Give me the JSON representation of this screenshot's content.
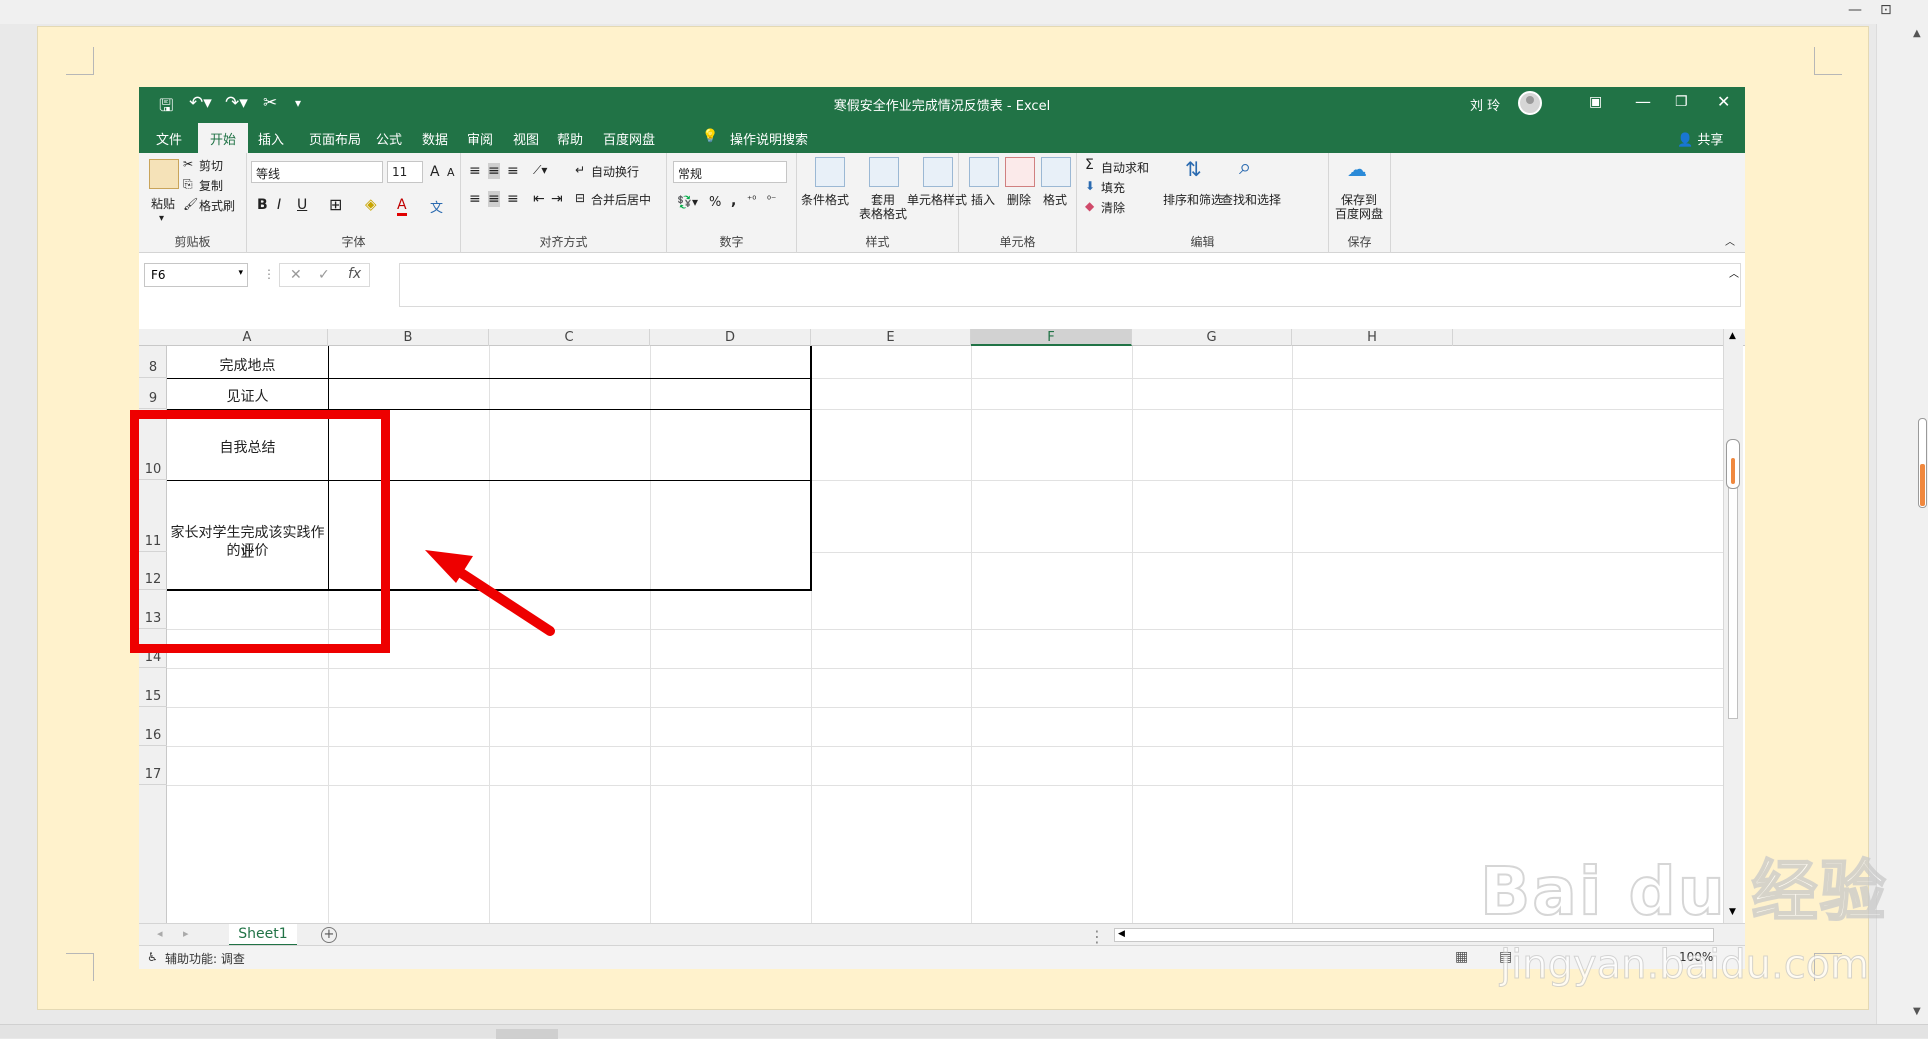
{
  "excel": {
    "title": "寒假安全作业完成情况反馈表 - Excel",
    "user": "刘 玲",
    "share": "共享",
    "tabs": [
      "文件",
      "开始",
      "插入",
      "页面布局",
      "公式",
      "数据",
      "审阅",
      "视图",
      "帮助",
      "百度网盘"
    ],
    "active_tab": "开始",
    "tell_me": "操作说明搜索",
    "ribbon": {
      "clipboard": {
        "paste": "粘贴",
        "cut": "剪切",
        "copy": "复制",
        "format_painter": "格式刷",
        "label": "剪贴板"
      },
      "font": {
        "font_name": "等线",
        "font_size": "11",
        "bold": "B",
        "italic": "I",
        "underline": "U",
        "label": "字体",
        "grow": "A",
        "shrink": "A",
        "color_a": "A",
        "wen": "文"
      },
      "alignment": {
        "wrap": "自动换行",
        "merge": "合并后居中",
        "label": "对齐方式"
      },
      "number": {
        "format": "常规",
        "percent": "%",
        "comma": ",",
        "label": "数字"
      },
      "styles": {
        "conditional": "条件格式",
        "table1": "套用",
        "table2": "表格格式",
        "cell_styles": "单元格样式",
        "label": "样式"
      },
      "cells": {
        "insert": "插入",
        "delete": "删除",
        "format": "格式",
        "label": "单元格"
      },
      "editing": {
        "autosum": "自动求和",
        "fill": "填充",
        "clear": "清除",
        "sort": "排序和筛选",
        "find": "查找和选择",
        "label": "编辑"
      },
      "save": {
        "save1": "保存到",
        "save2": "百度网盘",
        "label": "保存"
      }
    },
    "name_box": "F6",
    "columns": [
      "A",
      "B",
      "C",
      "D",
      "E",
      "F",
      "G",
      "H"
    ],
    "selected_column": "F",
    "rows": [
      "8",
      "9",
      "10",
      "11",
      "12",
      "13",
      "14",
      "15",
      "16",
      "17"
    ],
    "cells": {
      "a8": "完成地点",
      "a9": "见证人",
      "a10": "自我总结",
      "a11_line1": "家长对学生完成该实践作业",
      "a11_line2": "的评价"
    },
    "sheet_tab": "Sheet1",
    "status": "辅助功能: 调查",
    "zoom": "100%"
  },
  "viewer": {
    "minimize": "—",
    "restore": "⊡"
  },
  "watermark": {
    "logo": "Bai du 经验",
    "url": "jingyan.baidu.com"
  },
  "colors": {
    "excel_green": "#217346",
    "annotation_red": "#ee0000",
    "page_bg": "#fff2cc"
  }
}
